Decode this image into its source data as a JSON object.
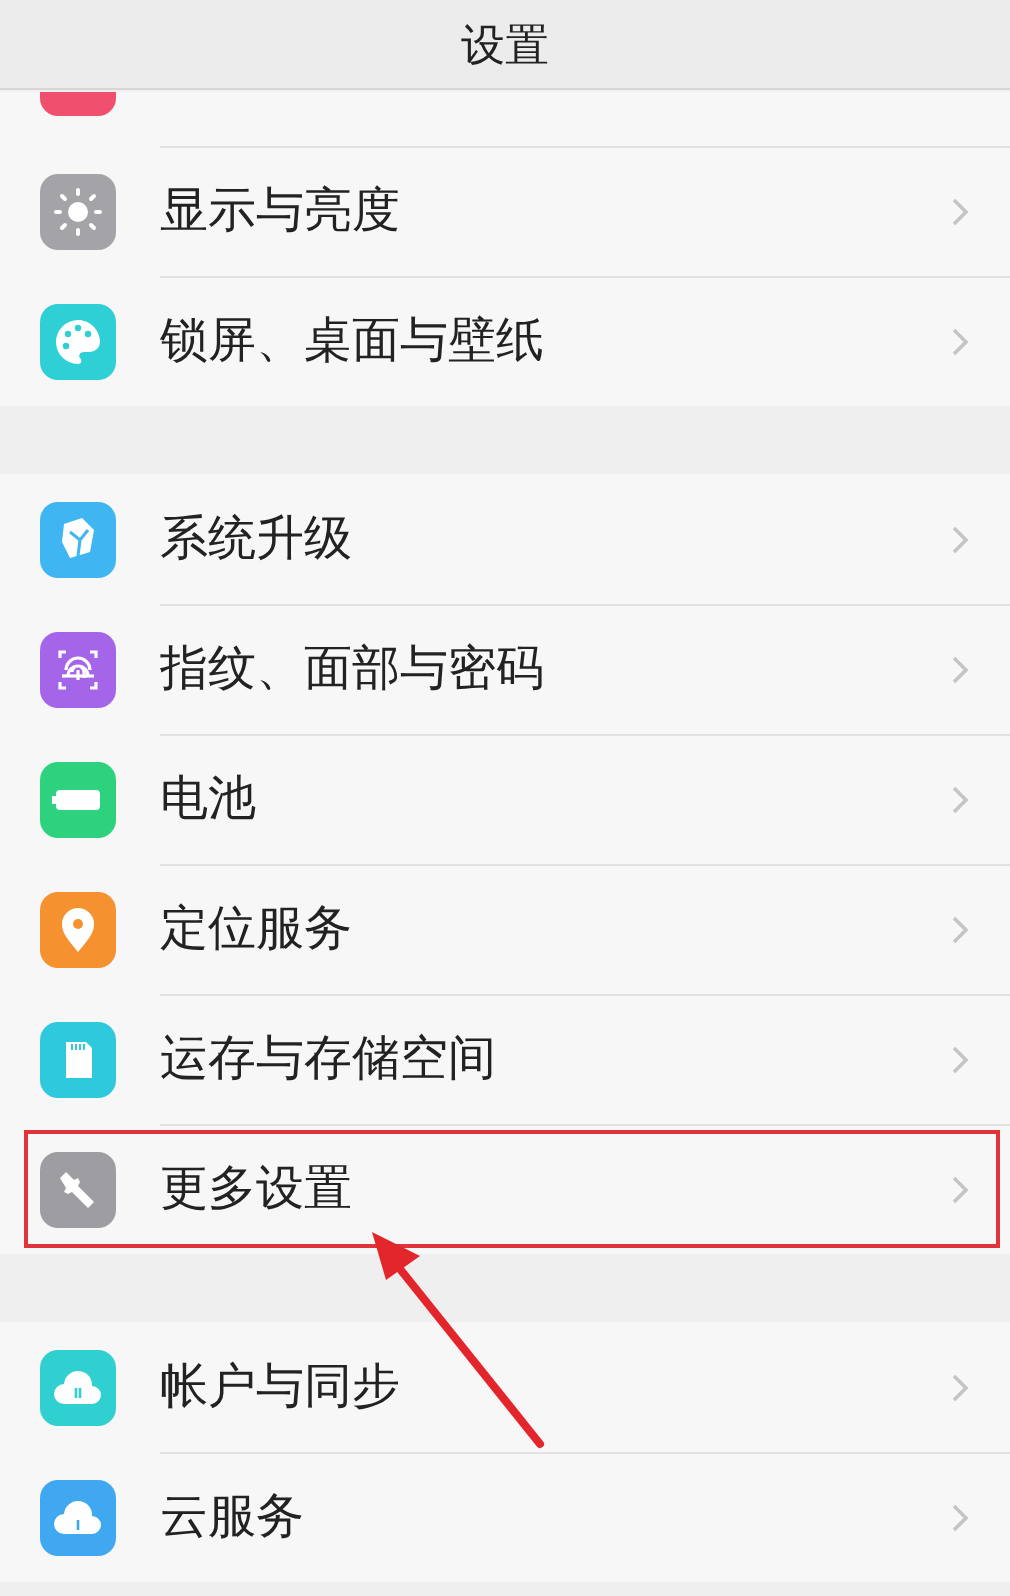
{
  "header": {
    "title": "设置"
  },
  "sections": [
    {
      "items": [
        {
          "kind": "cut",
          "color": "#f0506e",
          "highlighted": false
        },
        {
          "kind": "row",
          "label": "显示与亮度",
          "color": "#a3a3a8",
          "highlighted": false
        },
        {
          "kind": "row",
          "label": "锁屏、桌面与壁纸",
          "color": "#2fcfd6",
          "highlighted": false
        }
      ]
    },
    {
      "items": [
        {
          "kind": "row",
          "label": "系统升级",
          "color": "#3fb6f2",
          "highlighted": false
        },
        {
          "kind": "row",
          "label": "指纹、面部与密码",
          "color": "#a565e8",
          "highlighted": false
        },
        {
          "kind": "row",
          "label": "电池",
          "color": "#2ed27e",
          "highlighted": false
        },
        {
          "kind": "row",
          "label": "定位服务",
          "color": "#f6912f",
          "highlighted": false
        },
        {
          "kind": "row",
          "label": "运存与存储空间",
          "color": "#2fc9dd",
          "highlighted": false
        },
        {
          "kind": "row",
          "label": "更多设置",
          "color": "#9d9da2",
          "highlighted": true
        }
      ]
    },
    {
      "items": [
        {
          "kind": "row",
          "label": "帐户与同步",
          "color": "#2fd0cf",
          "highlighted": false
        },
        {
          "kind": "row",
          "label": "云服务",
          "color": "#3fa8f0",
          "highlighted": false
        }
      ]
    }
  ]
}
